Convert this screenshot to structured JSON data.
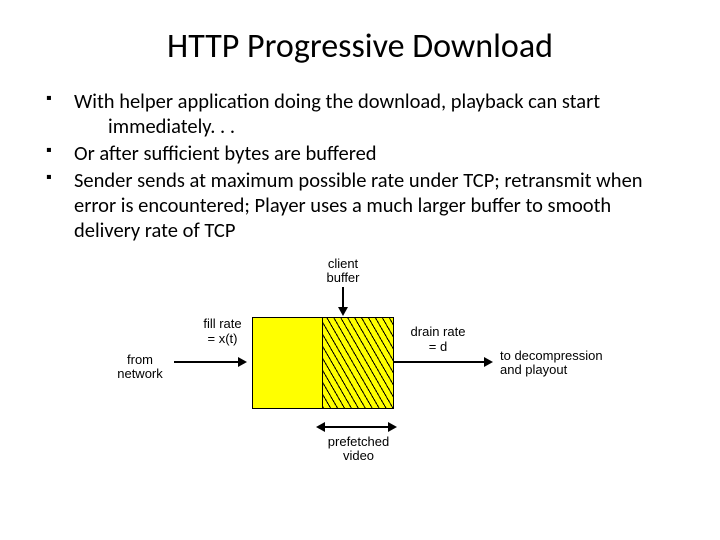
{
  "title": "HTTP Progressive Download",
  "bullets": [
    {
      "text": "With helper application doing the download, playback can start",
      "continuation": "immediately. . ."
    },
    {
      "text": "Or after sufficient bytes are buffered"
    },
    {
      "text": "Sender sends at maximum possible rate under TCP; retransmit when error is encountered; Player uses a much larger buffer to smooth delivery rate of TCP"
    }
  ],
  "diagram": {
    "labels": {
      "client_buffer": "client\nbuffer",
      "from_network": "from\nnetwork",
      "fill_rate": "fill rate\n= x(t)",
      "drain_rate": "drain rate\n= d",
      "to_decompression": "to decompression\nand playout",
      "prefetched_video": "prefetched\nvideo"
    }
  }
}
